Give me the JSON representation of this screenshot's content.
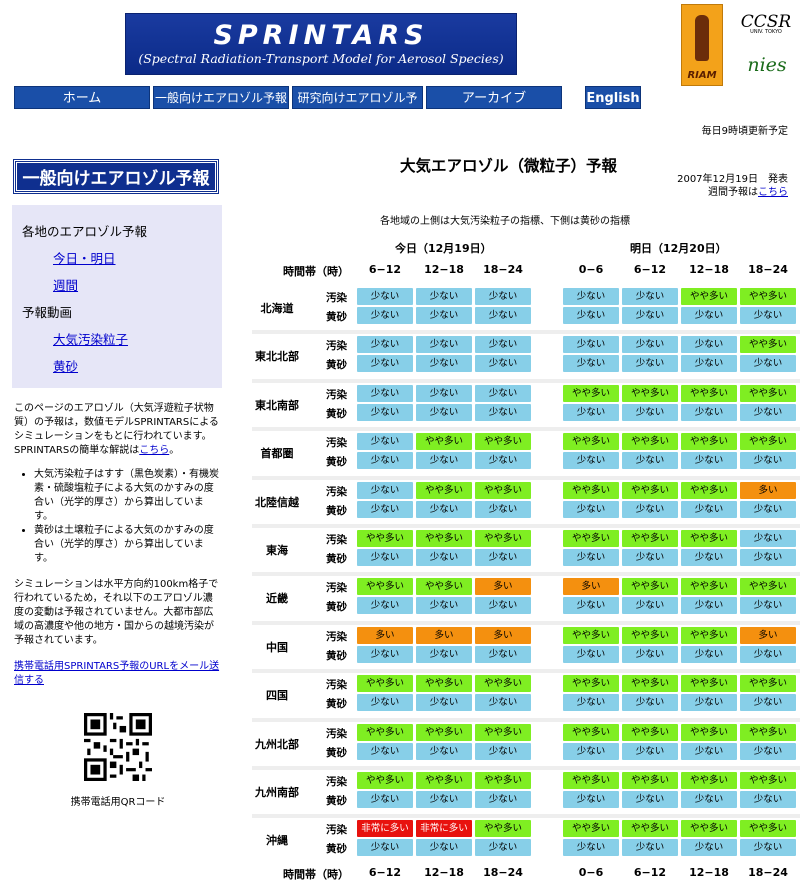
{
  "banner": {
    "title": "SPRINTARS",
    "subtitle": "(Spectral Radiation-Transport Model for Aerosol Species)"
  },
  "logos": {
    "riam": "RIAM",
    "ccsr": "CCSR",
    "ccsr_sub": "UNIV. TOKYO",
    "nies": "nies"
  },
  "nav": [
    "ホーム",
    "一般向けエアロゾル予報",
    "研究向けエアロゾル予報",
    "アーカイブ",
    "English"
  ],
  "update_note": "毎日9時頃更新予定",
  "sidebar": {
    "title": "一般向けエアロゾル予報",
    "menu": {
      "h1": "各地のエアロゾル予報",
      "l1": "今日・明日",
      "l2": "週間",
      "h2": "予報動画",
      "l3": "大気汚染粒子",
      "l4": "黄砂"
    },
    "intro": "このページのエアロゾル（大気浮遊粒子状物質）の予報は，数値モデルSPRINTARSによるシミュレーションをもとに行われています。SPRINTARSの簡単な解説は",
    "intro_link": "こちら",
    "intro_end": "。",
    "bullet1": "大気汚染粒子はすす（黒色炭素）・有機炭素・硫酸塩粒子による大気のかすみの度合い（光学的厚さ）から算出しています。",
    "bullet2": "黄砂は土壌粒子による大気のかすみの度合い（光学的厚さ）から算出しています。",
    "note": "シミュレーションは水平方向約100km格子で行われているため，それ以下のエアロゾル濃度の変動は予報されていません。大都市部広域の高濃度や他の地方・国からの越境汚染が予報されています。",
    "mail_link": "携帯電話用SPRINTARS予報のURLをメール送信する",
    "qr_label": "携帯電話用QRコード"
  },
  "main": {
    "title": "大気エアロゾル（微粒子）予報",
    "date": "2007年12月19日　発表",
    "weekly_prefix": "週間予報は",
    "weekly_link": "こちら",
    "legend_note": "各地域の上側は大気汚染粒子の指標、下側は黄砂の指標",
    "today": "今日（12月19日）",
    "tomorrow": "明日（12月20日）",
    "time_label": "時間帯（時）",
    "today_slots": [
      "6−12",
      "12−18",
      "18−24"
    ],
    "tomorrow_slots": [
      "0−6",
      "6−12",
      "12−18",
      "18−24"
    ],
    "kind_pollution": "汚染",
    "kind_dust": "黄砂"
  },
  "levels": {
    "1": "少ない",
    "2": "やや多い",
    "3": "多い",
    "4": "非常に多い"
  },
  "level_colors": {
    "1": "#87cfe8",
    "2": "#7fee22",
    "3": "#f4900f",
    "4": "#e8120e"
  },
  "regions": [
    {
      "name": "北海道",
      "pollution": [
        1,
        1,
        1,
        1,
        1,
        2,
        2
      ],
      "dust": [
        1,
        1,
        1,
        1,
        1,
        1,
        1
      ]
    },
    {
      "name": "東北北部",
      "pollution": [
        1,
        1,
        1,
        1,
        1,
        1,
        2
      ],
      "dust": [
        1,
        1,
        1,
        1,
        1,
        1,
        1
      ]
    },
    {
      "name": "東北南部",
      "pollution": [
        1,
        1,
        1,
        2,
        2,
        2,
        2
      ],
      "dust": [
        1,
        1,
        1,
        1,
        1,
        1,
        1
      ]
    },
    {
      "name": "首都圏",
      "pollution": [
        1,
        2,
        2,
        2,
        2,
        2,
        2
      ],
      "dust": [
        1,
        1,
        1,
        1,
        1,
        1,
        1
      ]
    },
    {
      "name": "北陸信越",
      "pollution": [
        1,
        2,
        2,
        2,
        2,
        2,
        3
      ],
      "dust": [
        1,
        1,
        1,
        1,
        1,
        1,
        1
      ]
    },
    {
      "name": "東海",
      "pollution": [
        2,
        2,
        2,
        2,
        2,
        2,
        1
      ],
      "dust": [
        1,
        1,
        1,
        1,
        1,
        1,
        1
      ]
    },
    {
      "name": "近畿",
      "pollution": [
        2,
        2,
        3,
        3,
        2,
        2,
        2
      ],
      "dust": [
        1,
        1,
        1,
        1,
        1,
        1,
        1
      ]
    },
    {
      "name": "中国",
      "pollution": [
        3,
        3,
        3,
        2,
        2,
        2,
        3
      ],
      "dust": [
        1,
        1,
        1,
        1,
        1,
        1,
        1
      ]
    },
    {
      "name": "四国",
      "pollution": [
        2,
        2,
        2,
        2,
        2,
        2,
        2
      ],
      "dust": [
        1,
        1,
        1,
        1,
        1,
        1,
        1
      ]
    },
    {
      "name": "九州北部",
      "pollution": [
        2,
        2,
        2,
        2,
        2,
        2,
        2
      ],
      "dust": [
        1,
        1,
        1,
        1,
        1,
        1,
        1
      ]
    },
    {
      "name": "九州南部",
      "pollution": [
        2,
        2,
        2,
        2,
        2,
        2,
        2
      ],
      "dust": [
        1,
        1,
        1,
        1,
        1,
        1,
        1
      ]
    },
    {
      "name": "沖縄",
      "pollution": [
        4,
        4,
        2,
        2,
        2,
        2,
        2
      ],
      "dust": [
        1,
        1,
        1,
        1,
        1,
        1,
        1
      ]
    }
  ]
}
